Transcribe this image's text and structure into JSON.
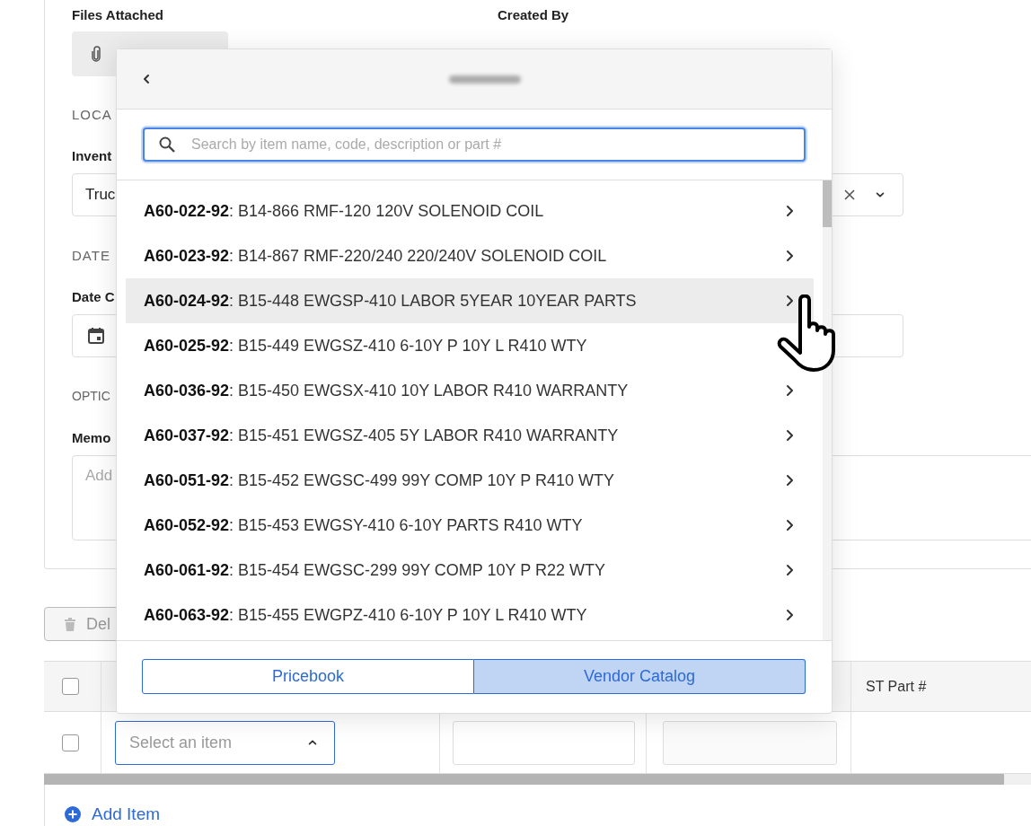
{
  "form": {
    "files_attached_label": "Files Attached",
    "created_by_label": "Created By",
    "location_heading": "LOCA",
    "inventory_label": "Invent",
    "inventory_value": "Truc",
    "date_heading": "DATE",
    "date_label": "Date C",
    "options_heading": "OPTIC",
    "memo_label": "Memo",
    "memo_placeholder": "Add"
  },
  "toolbar": {
    "delete_button": "Del"
  },
  "table": {
    "header_checked": false,
    "columns": [
      {
        "label": "ST Part #"
      }
    ],
    "rows": [
      {
        "checked": false,
        "item_placeholder": "Select an item"
      }
    ]
  },
  "add_item": "Add Item",
  "picker": {
    "search_placeholder": "Search by item name, code, description or part #",
    "items": [
      {
        "text": "**A60-022-92**: B14-866 RMF-120 120V SOLENOID COIL",
        "highlighted": false
      },
      {
        "text": "**A60-023-92**: B14-867 RMF-220/240 220/240V SOLENOID COIL",
        "highlighted": false
      },
      {
        "text": "**A60-024-92**: B15-448 EWGSP-410 LABOR 5YEAR 10YEAR PARTS",
        "highlighted": true
      },
      {
        "text": "**A60-025-92**: B15-449 EWGSZ-410 6-10Y P 10Y L R410 WTY",
        "highlighted": false
      },
      {
        "text": "**A60-036-92**: B15-450 EWGSX-410 10Y LABOR R410 WARRANTY",
        "highlighted": false
      },
      {
        "text": "**A60-037-92**: B15-451 EWGSZ-405 5Y LABOR R410 WARRANTY",
        "highlighted": false
      },
      {
        "text": "**A60-051-92**: B15-452 EWGSC-499 99Y COMP 10Y P R410 WTY",
        "highlighted": false
      },
      {
        "text": "**A60-052-92**: B15-453 EWGSY-410 6-10Y PARTS R410 WTY",
        "highlighted": false
      },
      {
        "text": "**A60-061-92**: B15-454 EWGSC-299 99Y COMP 10Y P R22 WTY",
        "highlighted": false
      },
      {
        "text": "**A60-063-92**: B15-455 EWGPZ-410 6-10Y P 10Y L R410 WTY",
        "highlighted": false
      }
    ],
    "sources": [
      {
        "label": "Pricebook",
        "selected": false
      },
      {
        "label": "Vendor Catalog",
        "selected": true
      }
    ]
  }
}
